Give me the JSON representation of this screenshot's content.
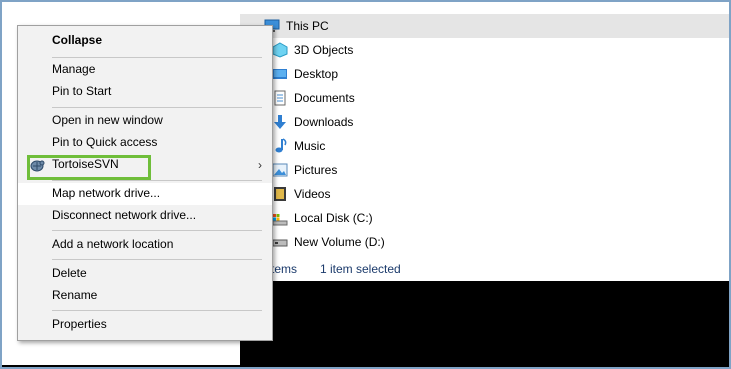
{
  "menu": {
    "items": [
      {
        "label": "Collapse",
        "bold": true
      },
      {
        "label": "Manage"
      },
      {
        "label": "Pin to Start"
      },
      {
        "label": "Open in new window"
      },
      {
        "label": "Pin to Quick access"
      },
      {
        "label": "TortoiseSVN",
        "submenu": true
      },
      {
        "label": "Map network drive..."
      },
      {
        "label": "Disconnect network drive..."
      },
      {
        "label": "Add a network location"
      },
      {
        "label": "Delete"
      },
      {
        "label": "Rename"
      },
      {
        "label": "Properties"
      }
    ],
    "submenu_glyph": "›"
  },
  "explorer": {
    "selected_item": "This PC",
    "tree": [
      {
        "label": "This PC",
        "icon": "computer-icon"
      },
      {
        "label": "3D Objects",
        "icon": "3d-objects-icon"
      },
      {
        "label": "Desktop",
        "icon": "desktop-folder-icon"
      },
      {
        "label": "Documents",
        "icon": "documents-folder-icon"
      },
      {
        "label": "Downloads",
        "icon": "downloads-folder-icon"
      },
      {
        "label": "Music",
        "icon": "music-folder-icon"
      },
      {
        "label": "Pictures",
        "icon": "pictures-folder-icon"
      },
      {
        "label": "Videos",
        "icon": "videos-folder-icon"
      },
      {
        "label": "Local Disk (C:)",
        "icon": "local-disk-icon"
      },
      {
        "label": "New Volume (D:)",
        "icon": "drive-icon"
      }
    ],
    "status": {
      "items_text": "tems",
      "selected_text": "1 item selected"
    }
  },
  "colors": {
    "highlight_outline": "#6fbe3a",
    "selection_bg": "#e5e5e5",
    "frame_border": "#7fa3c6"
  }
}
